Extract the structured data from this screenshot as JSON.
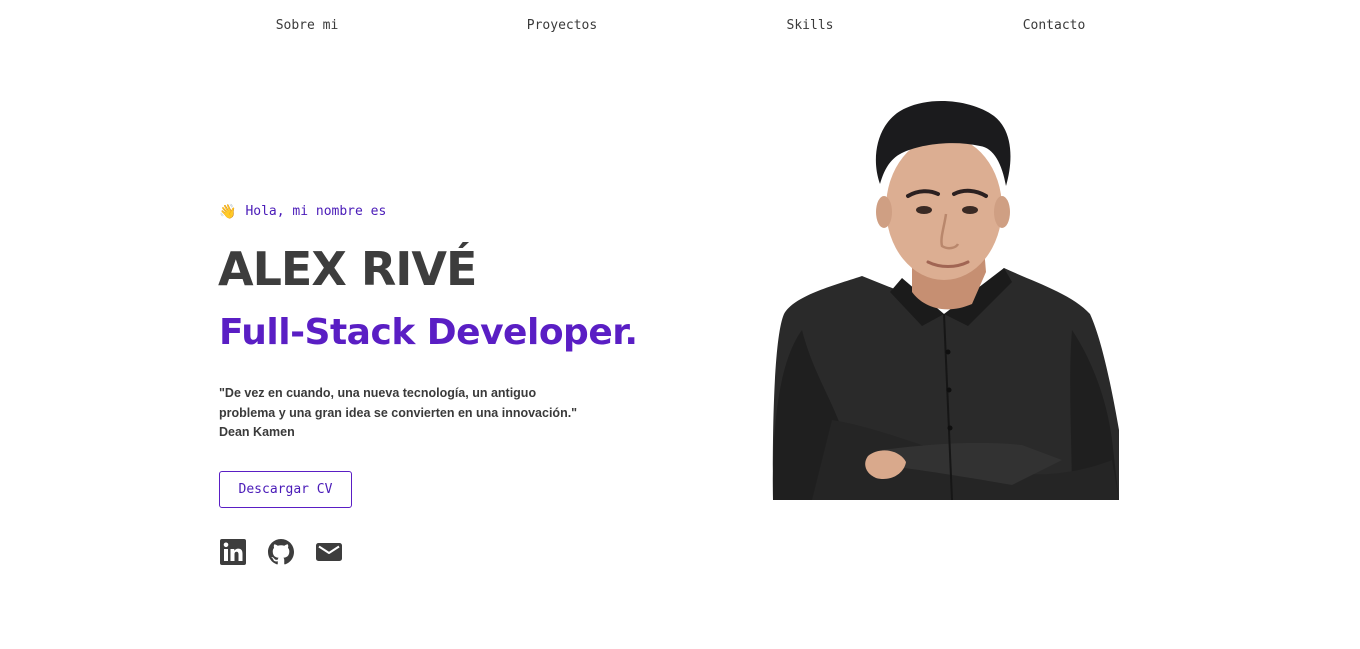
{
  "nav": {
    "items": [
      {
        "label": "Sobre mi"
      },
      {
        "label": "Proyectos"
      },
      {
        "label": "Skills"
      },
      {
        "label": "Contacto"
      }
    ]
  },
  "hero": {
    "greeting_icon": "waving-hand-icon",
    "greeting": "Hola, mi nombre es",
    "name": "ALEX RIVÉ",
    "role": "Full-Stack Developer.",
    "quote": "\"De vez en cuando, una nueva tecnología, un antiguo problema y una gran idea se convierten en una innovación.\"",
    "quote_author": "Dean Kamen",
    "cv_button": "Descargar CV"
  },
  "socials": [
    {
      "icon": "linkedin-icon"
    },
    {
      "icon": "github-icon"
    },
    {
      "icon": "mail-icon"
    }
  ],
  "colors": {
    "accent": "#5a1ec4",
    "text": "#3d3d3d",
    "background": "#ffffff"
  }
}
